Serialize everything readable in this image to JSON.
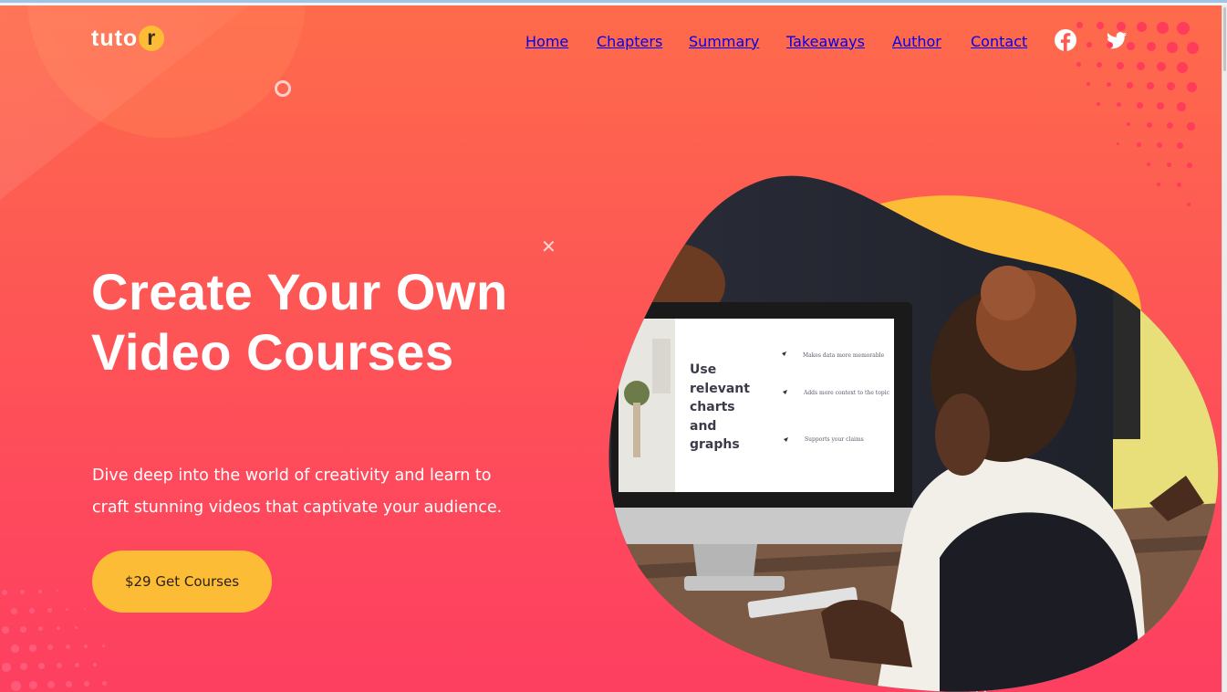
{
  "logo": {
    "text_main": "tuto",
    "text_badge": "r"
  },
  "nav": {
    "items": [
      {
        "id": "home",
        "label": "Home"
      },
      {
        "id": "chapters",
        "label": "Chapters"
      },
      {
        "id": "summary",
        "label": "Summary"
      },
      {
        "id": "takeaways",
        "label": "Takeaways"
      },
      {
        "id": "author",
        "label": "Author"
      },
      {
        "id": "contact",
        "label": "Contact"
      }
    ],
    "social": [
      {
        "icon": "facebook-icon"
      },
      {
        "icon": "twitter-icon"
      }
    ]
  },
  "hero": {
    "title": "Create Your Own Video Courses",
    "subtitle": "Dive deep into the world of creativity and learn to craft stunning videos that captivate your audience.",
    "cta_label": "$29 Get Courses"
  },
  "screen": {
    "heading_lines": [
      "Use",
      "relevant",
      "charts",
      "and",
      "graphs"
    ],
    "bullets": [
      "Makes data more memorable",
      "Adds more context to the topic",
      "Supports your claims"
    ]
  },
  "colors": {
    "hero_top": "#fe6b4b",
    "hero_bottom": "#fd3f60",
    "accent_yellow": "#fdbc35",
    "text_white": "#ffffff"
  }
}
